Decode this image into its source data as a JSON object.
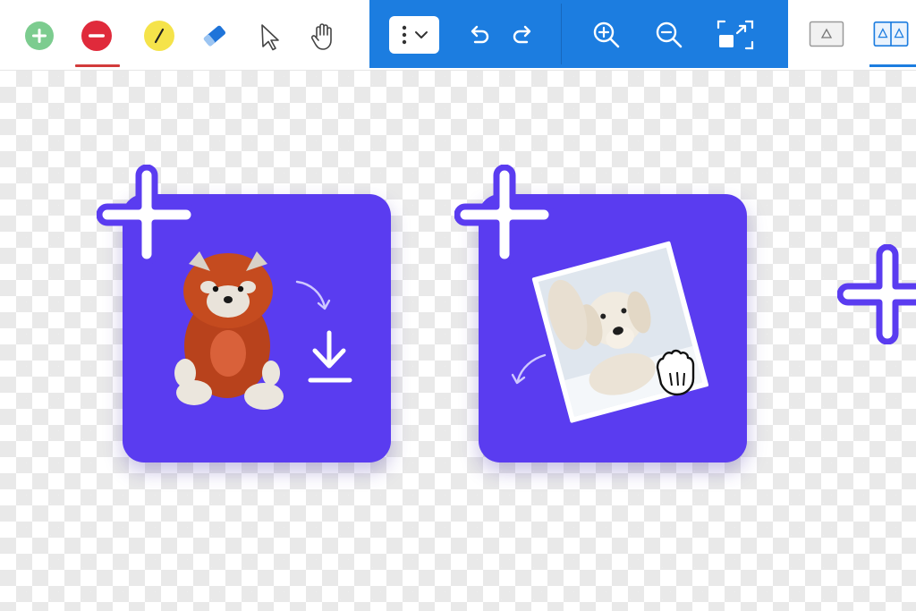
{
  "toolbar": {
    "tools": [
      {
        "name": "add",
        "icon": "plus-circle-icon",
        "color": "#7ccc8f"
      },
      {
        "name": "remove",
        "icon": "minus-circle-icon",
        "color": "#e02a3b",
        "active": true
      },
      {
        "name": "brush",
        "icon": "pencil-icon",
        "color": "#f5e34a"
      },
      {
        "name": "eraser",
        "icon": "eraser-icon",
        "color": "#1f74d9"
      },
      {
        "name": "pointer",
        "icon": "cursor-arrow-icon"
      },
      {
        "name": "pan",
        "icon": "hand-icon"
      }
    ],
    "band": {
      "color": "#1c7de0",
      "buttons": [
        "select-menu",
        "undo",
        "redo",
        "zoom-in",
        "zoom-out",
        "fit-to-screen"
      ]
    },
    "views": [
      {
        "name": "single-view",
        "icon": "single-view-icon"
      },
      {
        "name": "split-view",
        "icon": "split-view-icon",
        "active": true
      }
    ]
  },
  "canvas": {
    "cards": [
      {
        "name": "plush-fox-card",
        "accent": "#5a3cf0",
        "icons": [
          "curved-arrow-icon",
          "download-icon"
        ]
      },
      {
        "name": "dog-photo-card",
        "accent": "#5a3cf0",
        "icons": [
          "curved-arrow-icon",
          "grab-hand-icon"
        ]
      }
    ]
  }
}
